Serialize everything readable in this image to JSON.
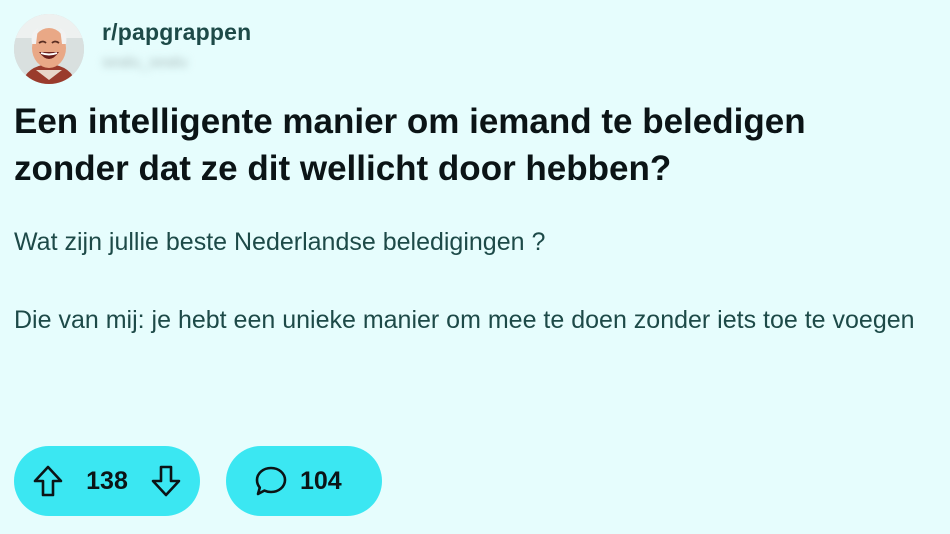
{
  "post": {
    "subreddit": "r/papgrappen",
    "username": "sealu_sealu",
    "title": "Een intelligente manier om iemand te beledigen zonder dat ze dit wellicht door hebben?",
    "body": [
      "Wat zijn jullie beste Nederlandse beledigingen ?",
      "Die van mij: je hebt een unieke manier om mee te doen zonder iets toe te voegen"
    ]
  },
  "actions": {
    "upvote_icon": "arrow-up-icon",
    "vote_count": "138",
    "downvote_icon": "arrow-down-icon",
    "comment_icon": "speech-bubble-icon",
    "comment_count": "104"
  },
  "colors": {
    "background": "#e6fdfd",
    "pill": "#3be7f2",
    "subreddit_text": "#1d4a48",
    "title_text": "#0b1416"
  }
}
